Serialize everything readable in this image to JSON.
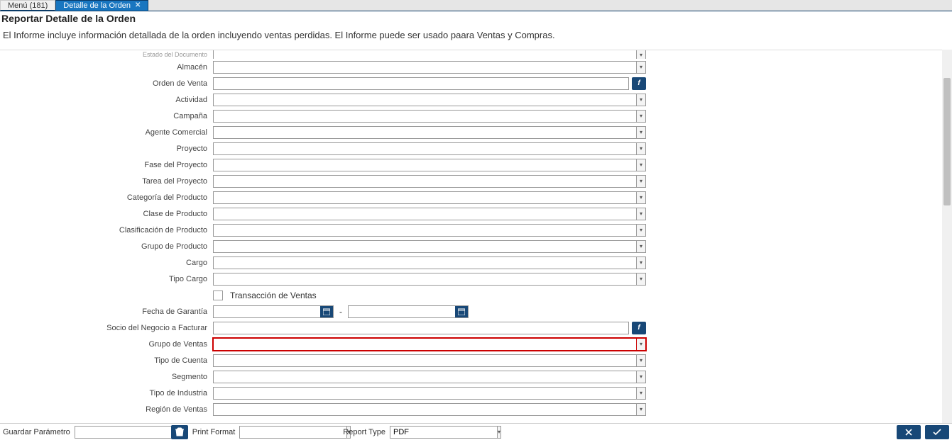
{
  "tabs": [
    {
      "label": "Menú (181)",
      "active": false
    },
    {
      "label": "Detalle de la Orden",
      "active": true
    }
  ],
  "header": {
    "title": "Reportar Detalle de la Orden",
    "subtitle": "El Informe incluye información detallada de la orden incluyendo ventas perdidas. El Informe puede ser usado paara Ventas y Compras."
  },
  "fields": {
    "estado_documento": {
      "label": "Estado del Documento",
      "value": ""
    },
    "almacen": {
      "label": "Almacén",
      "value": ""
    },
    "orden_venta": {
      "label": "Orden de Venta",
      "value": ""
    },
    "actividad": {
      "label": "Actividad",
      "value": ""
    },
    "campana": {
      "label": "Campaña",
      "value": ""
    },
    "agente_comercial": {
      "label": "Agente Comercial",
      "value": ""
    },
    "proyecto": {
      "label": "Proyecto",
      "value": ""
    },
    "fase_proyecto": {
      "label": "Fase del Proyecto",
      "value": ""
    },
    "tarea_proyecto": {
      "label": "Tarea del Proyecto",
      "value": ""
    },
    "categoria_producto": {
      "label": "Categoría del Producto",
      "value": ""
    },
    "clase_producto": {
      "label": "Clase de Producto",
      "value": ""
    },
    "clasificacion_producto": {
      "label": "Clasificación de Producto",
      "value": ""
    },
    "grupo_producto": {
      "label": "Grupo de Producto",
      "value": ""
    },
    "cargo": {
      "label": "Cargo",
      "value": ""
    },
    "tipo_cargo": {
      "label": "Tipo Cargo",
      "value": ""
    },
    "transaccion_ventas": {
      "label": "Transacción de Ventas",
      "checked": false
    },
    "fecha_garantia": {
      "label": "Fecha de Garantía",
      "from": "",
      "to": ""
    },
    "socio_facturar": {
      "label": "Socio del Negocio a Facturar",
      "value": ""
    },
    "grupo_ventas": {
      "label": "Grupo de Ventas",
      "value": ""
    },
    "tipo_cuenta": {
      "label": "Tipo de Cuenta",
      "value": ""
    },
    "segmento": {
      "label": "Segmento",
      "value": ""
    },
    "tipo_industria": {
      "label": "Tipo de Industria",
      "value": ""
    },
    "region_ventas": {
      "label": "Región de Ventas",
      "value": ""
    }
  },
  "footer": {
    "guardar_parametro_label": "Guardar Parámetro",
    "guardar_parametro_value": "",
    "print_format_label": "Print Format",
    "print_format_value": "",
    "report_type_label": "Report Type",
    "report_type_value": "PDF"
  }
}
